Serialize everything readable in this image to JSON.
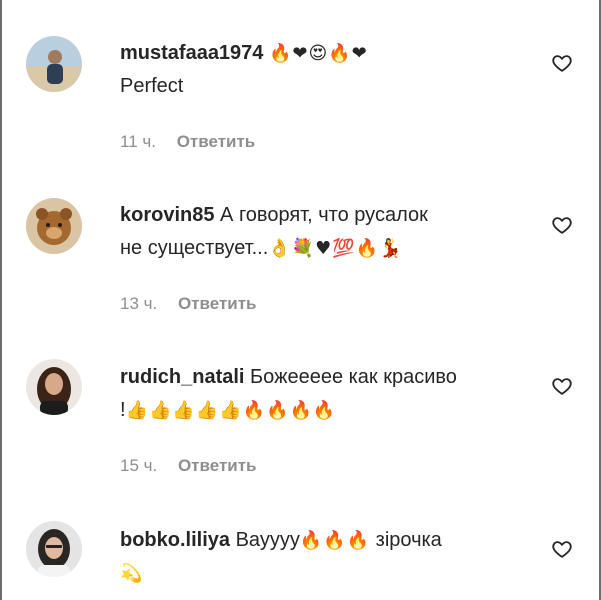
{
  "icons": {
    "like": "heart-outline-icon"
  },
  "comments": [
    {
      "username": "mustafaaa1974",
      "line1": "",
      "line1_emoji": "🔥❤😍🔥❤",
      "line2": "Perfect",
      "line2_emoji": "",
      "time": "11 ч.",
      "reply": "Ответить"
    },
    {
      "username": "korovin85",
      "line1": "А говорят, что русалок",
      "line1_emoji": "",
      "line2": "не существует...",
      "line2_emoji": "👌💐♥💯🔥💃",
      "time": "13 ч.",
      "reply": "Ответить"
    },
    {
      "username": "rudich_natali",
      "line1": "Божеееее как красиво",
      "line1_emoji": "",
      "line2": "!",
      "line2_emoji": "👍👍👍👍👍🔥🔥🔥🔥",
      "time": "15 ч.",
      "reply": "Ответить"
    },
    {
      "username": "bobko.liliya",
      "line1": "Вауууу",
      "line1_emoji": "🔥🔥🔥",
      "line1_after": "зірочка",
      "line2": "",
      "line2_emoji": "💫",
      "time": "",
      "reply": ""
    }
  ]
}
